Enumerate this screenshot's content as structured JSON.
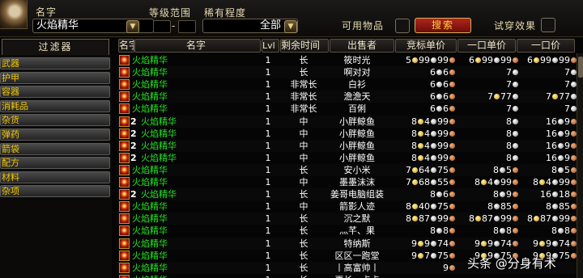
{
  "top": {
    "name_label": "名字",
    "name_value": "火焰精华",
    "level_label": "等级范围",
    "rarity_label": "稀有程度",
    "rarity_value": "全部",
    "usable_label": "可用物品",
    "search_button": "搜索",
    "try_on_label": "试穿效果"
  },
  "filter_tab": "过滤器",
  "categories": [
    "武器",
    "护甲",
    "容器",
    "消耗品",
    "杂货",
    "弹药",
    "箭袋",
    "配方",
    "材料",
    "杂项"
  ],
  "table": {
    "headers": {
      "name": "名字",
      "level": "Lvl",
      "time": "剩余时间",
      "seller": "出售者",
      "bid": "竞标单价",
      "unit_buyout": "一口单价",
      "buyout": "一口价"
    },
    "rows": [
      {
        "qty": "",
        "name": "火焰精华",
        "lvl": "1",
        "time": "长",
        "seller": "筱时光",
        "bid": [
          "5",
          "99",
          "99"
        ],
        "unit": [
          "6",
          "99",
          "99"
        ],
        "bo": [
          "6",
          "99",
          "99"
        ]
      },
      {
        "qty": "",
        "name": "火焰精华",
        "lvl": "1",
        "time": "长",
        "seller": "啊对对",
        "bid": [
          "",
          "6",
          "6"
        ],
        "unit": [
          "",
          "7",
          ""
        ],
        "bo": [
          "",
          "7",
          ""
        ]
      },
      {
        "qty": "",
        "name": "火焰精华",
        "lvl": "1",
        "time": "非常长",
        "seller": "白衫",
        "bid": [
          "",
          "6",
          "6"
        ],
        "unit": [
          "",
          "7",
          ""
        ],
        "bo": [
          "",
          "7",
          ""
        ]
      },
      {
        "qty": "",
        "name": "火焰精华",
        "lvl": "1",
        "time": "非常长",
        "seller": "澹澹天",
        "bid": [
          "",
          "6",
          "6"
        ],
        "unit": [
          "7",
          "77",
          ""
        ],
        "bo": [
          "7",
          "77",
          ""
        ]
      },
      {
        "qty": "",
        "name": "火焰精华",
        "lvl": "1",
        "time": "非常长",
        "seller": "百俐",
        "bid": [
          "",
          "6",
          "6"
        ],
        "unit": [
          "",
          "7",
          ""
        ],
        "bo": [
          "",
          "7",
          ""
        ]
      },
      {
        "qty": "2",
        "name": "火焰精华",
        "lvl": "1",
        "time": "中",
        "seller": "小胖鲸鱼",
        "bid": [
          "8",
          "4",
          "99"
        ],
        "unit": [
          "",
          "8",
          ""
        ],
        "bo": [
          "",
          "16",
          "9"
        ]
      },
      {
        "qty": "2",
        "name": "火焰精华",
        "lvl": "1",
        "time": "中",
        "seller": "小胖鲸鱼",
        "bid": [
          "8",
          "4",
          "99"
        ],
        "unit": [
          "",
          "8",
          ""
        ],
        "bo": [
          "",
          "16",
          "9"
        ]
      },
      {
        "qty": "2",
        "name": "火焰精华",
        "lvl": "1",
        "time": "中",
        "seller": "小胖鲸鱼",
        "bid": [
          "8",
          "4",
          "99"
        ],
        "unit": [
          "",
          "8",
          ""
        ],
        "bo": [
          "",
          "16",
          "9"
        ]
      },
      {
        "qty": "2",
        "name": "火焰精华",
        "lvl": "1",
        "time": "中",
        "seller": "小胖鲸鱼",
        "bid": [
          "8",
          "4",
          "99"
        ],
        "unit": [
          "",
          "8",
          ""
        ],
        "bo": [
          "",
          "16",
          "9"
        ]
      },
      {
        "qty": "",
        "name": "火焰精华",
        "lvl": "1",
        "time": "长",
        "seller": "安小米",
        "bid": [
          "7",
          "64",
          "75"
        ],
        "unit": [
          "",
          "8",
          "5"
        ],
        "bo": [
          "",
          "8",
          "5"
        ]
      },
      {
        "qty": "",
        "name": "火焰精华",
        "lvl": "1",
        "time": "中",
        "seller": "墨墨沫沫",
        "bid": [
          "7",
          "68",
          "55"
        ],
        "unit": [
          "8",
          "4",
          "99"
        ],
        "bo": [
          "8",
          "4",
          "99"
        ]
      },
      {
        "qty": "2",
        "name": "火焰精华",
        "lvl": "1",
        "time": "长",
        "seller": "姜哥电脑组装",
        "bid": [
          "",
          "8",
          "6"
        ],
        "unit": [
          "",
          "8",
          "9"
        ],
        "bo": [
          "",
          "16",
          "18"
        ]
      },
      {
        "qty": "",
        "name": "火焰精华",
        "lvl": "1",
        "time": "中",
        "seller": "箭影人迹",
        "bid": [
          "8",
          "40",
          "75"
        ],
        "unit": [
          "",
          "8",
          "85"
        ],
        "bo": [
          "",
          "8",
          "85"
        ]
      },
      {
        "qty": "",
        "name": "火焰精华",
        "lvl": "1",
        "time": "长",
        "seller": "沉之默",
        "bid": [
          "8",
          "87",
          "99"
        ],
        "unit": [
          "8",
          "87",
          "99"
        ],
        "bo": [
          "8",
          "87",
          "99"
        ]
      },
      {
        "qty": "",
        "name": "火焰精华",
        "lvl": "1",
        "time": "长",
        "seller": "灬芊、果",
        "bid": [
          "",
          "8",
          "8"
        ],
        "unit": [
          "",
          "8",
          "8"
        ],
        "bo": [
          "",
          "8",
          "8"
        ]
      },
      {
        "qty": "",
        "name": "火焰精华",
        "lvl": "1",
        "time": "长",
        "seller": "特纳斯",
        "bid": [
          "9",
          "9",
          "74"
        ],
        "unit": [
          "9",
          "9",
          "74"
        ],
        "bo": [
          "9",
          "9",
          "74"
        ]
      },
      {
        "qty": "",
        "name": "火焰精华",
        "lvl": "1",
        "time": "长",
        "seller": "区区一跑堂",
        "bid": [
          "9",
          "7",
          "75"
        ],
        "unit": [
          "9",
          "9",
          "75"
        ],
        "bo": [
          "9",
          "9",
          "75"
        ]
      },
      {
        "qty": "",
        "name": "火焰精华",
        "lvl": "1",
        "time": "长",
        "seller": "丨高富帅丨",
        "bid": [
          "",
          "",
          "9"
        ],
        "unit": [
          "",
          "",
          ""
        ],
        "bo": [
          "",
          "",
          ""
        ]
      },
      {
        "qty": "",
        "name": "火焰精华",
        "lvl": "1",
        "time": "长",
        "seller": "再长一点点",
        "bid": [
          "",
          "",
          ""
        ],
        "unit": [
          "",
          "",
          ""
        ],
        "bo": [
          "",
          "",
          ""
        ]
      }
    ]
  },
  "watermark": "头条 @分身有术",
  "icons": {
    "ddarrow": "chevron-down-icon",
    "item": "fire-essence-icon",
    "gold": "gold-coin-icon",
    "silver": "silver-coin-icon",
    "copper": "copper-coin-icon"
  }
}
